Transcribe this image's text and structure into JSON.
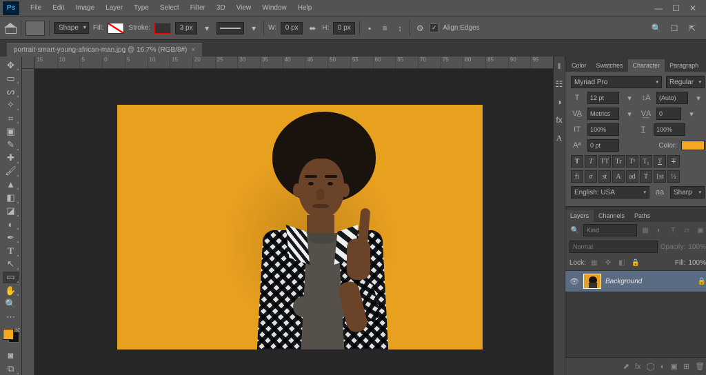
{
  "menubar": {
    "items": [
      "File",
      "Edit",
      "Image",
      "Layer",
      "Type",
      "Select",
      "Filter",
      "3D",
      "View",
      "Window",
      "Help"
    ]
  },
  "optbar": {
    "shape_label": "Shape",
    "fill_label": "Fill:",
    "stroke_label": "Stroke:",
    "stroke_width": "3 px",
    "w_label": "W:",
    "w_val": "0 px",
    "link_icon": "⬌",
    "h_label": "H:",
    "h_val": "0 px",
    "align_edges": "Align Edges"
  },
  "doc": {
    "title": "portrait-smart-young-african-man.jpg @ 16.7% (RGB/8#)"
  },
  "ruler_ticks": [
    "15",
    "10",
    "5",
    "0",
    "5",
    "10",
    "15",
    "20",
    "25",
    "30",
    "35",
    "40",
    "45",
    "50",
    "55",
    "60",
    "65",
    "70",
    "75",
    "80",
    "85",
    "90",
    "95"
  ],
  "tools": [
    {
      "name": "move",
      "g": "✥"
    },
    {
      "name": "marquee",
      "g": "▭"
    },
    {
      "name": "lasso",
      "g": "ᔕ"
    },
    {
      "name": "magic-wand",
      "g": "✧"
    },
    {
      "name": "crop",
      "g": "⌗"
    },
    {
      "name": "frame",
      "g": "▣"
    },
    {
      "name": "eyedropper",
      "g": "✎"
    },
    {
      "name": "healing",
      "g": "✚"
    },
    {
      "name": "brush",
      "g": "🖌"
    },
    {
      "name": "clone",
      "g": "✥"
    },
    {
      "name": "eraser",
      "g": "◧"
    },
    {
      "name": "gradient",
      "g": "◪"
    },
    {
      "name": "dodge",
      "g": "◐"
    },
    {
      "name": "pen",
      "g": "✒"
    },
    {
      "name": "type",
      "g": "T"
    },
    {
      "name": "path",
      "g": "↖"
    },
    {
      "name": "shape",
      "g": "▭",
      "active": true
    },
    {
      "name": "hand",
      "g": "✋"
    },
    {
      "name": "zoom",
      "g": "🔍"
    },
    {
      "name": "more",
      "g": "⋯"
    }
  ],
  "panelicons": [
    {
      "name": "history",
      "g": "↺"
    },
    {
      "name": "brushes",
      "g": "☰"
    },
    {
      "name": "clone-src",
      "g": "✥"
    },
    {
      "name": "paragraph",
      "g": "¶"
    },
    {
      "name": "glyphs",
      "g": "A"
    }
  ],
  "panels": {
    "top_tabs": [
      "Color",
      "Swatches",
      "Character",
      "Paragraph"
    ],
    "top_active": "Character"
  },
  "character": {
    "font": "Myriad Pro",
    "style": "Regular",
    "size": "12 pt",
    "leading": "(Auto)",
    "kerning": "Metrics",
    "tracking": "0",
    "vscale": "100%",
    "hscale": "100%",
    "baseline": "0 pt",
    "color_label": "Color:",
    "lang": "English: USA",
    "aa_label": "aa",
    "aa": "Sharp",
    "faux": [
      "T",
      "T",
      "TT",
      "Tr",
      "T¹",
      "T₁",
      "T"
    ],
    "ot": [
      "fi",
      "σ",
      "st",
      "A",
      "ad",
      "T",
      "1st",
      "½"
    ]
  },
  "layers": {
    "tabs": [
      "Layers",
      "Channels",
      "Paths"
    ],
    "active": "Layers",
    "filter_placeholder": "Kind",
    "blend": "Normal",
    "opacity_label": "Opacity:",
    "opacity": "100%",
    "lock_label": "Lock:",
    "fill_label": "Fill:",
    "fill": "100%",
    "items": [
      {
        "name": "Background",
        "locked": true
      }
    ]
  }
}
